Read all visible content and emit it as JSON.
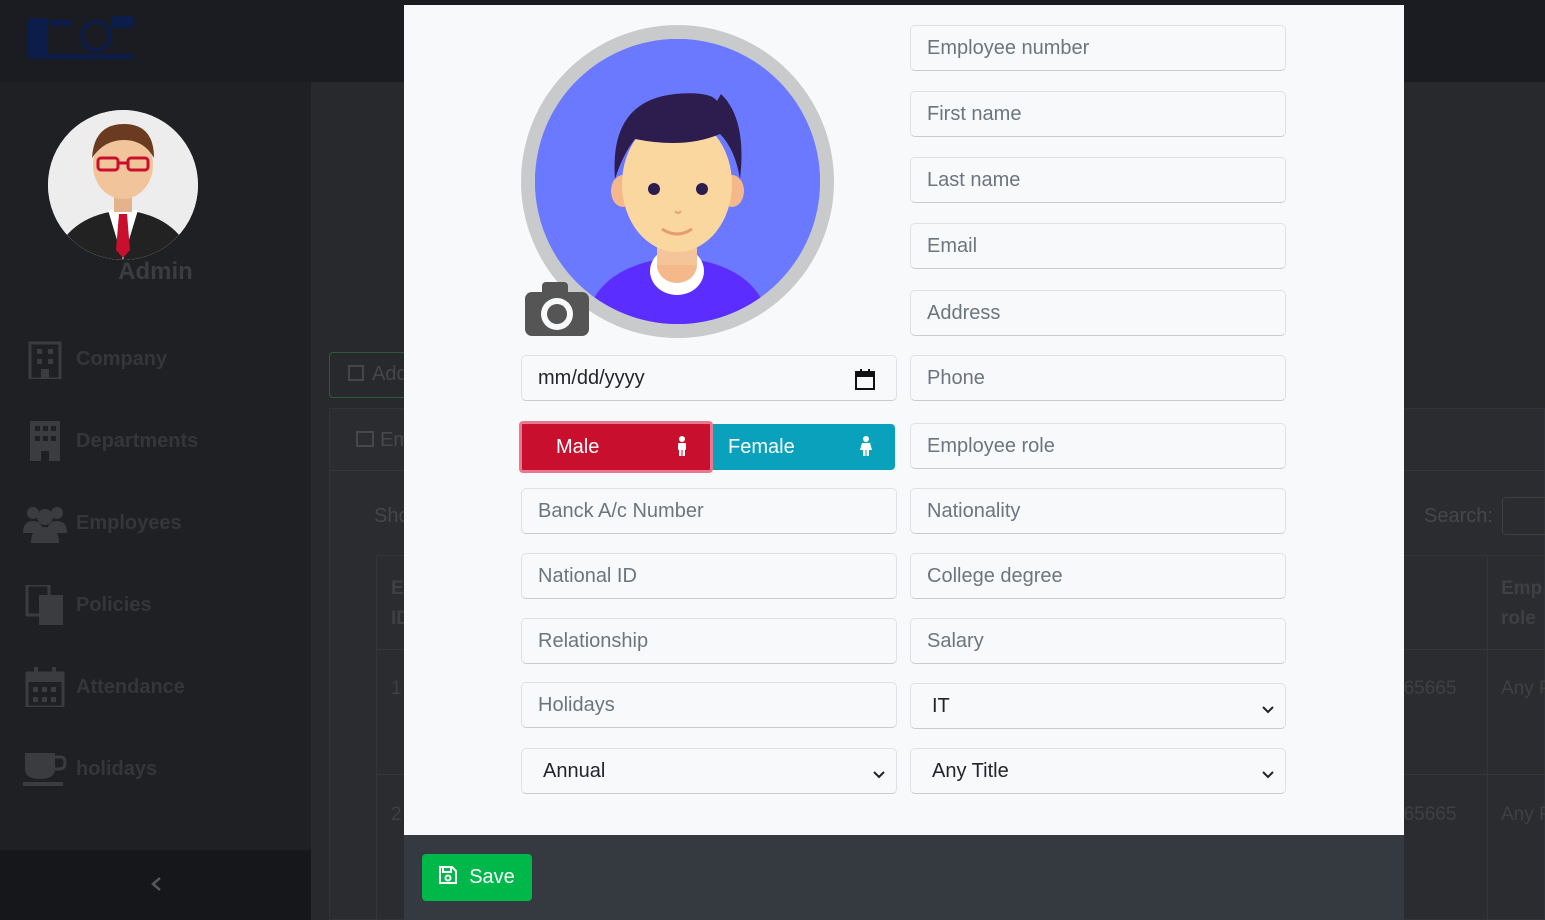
{
  "sidebar": {
    "admin_label": "Admin",
    "items": [
      {
        "label": "Company",
        "icon": "building-icon"
      },
      {
        "label": "Departments",
        "icon": "office-building-icon"
      },
      {
        "label": "Employees",
        "icon": "users-icon"
      },
      {
        "label": "Policies",
        "icon": "documents-icon"
      },
      {
        "label": "Attendance",
        "icon": "calendar-icon"
      },
      {
        "label": "holidays",
        "icon": "coffee-cup-icon"
      }
    ],
    "collapse_icon": "chevron-left-icon"
  },
  "background": {
    "add_button_label": "Add",
    "card_header_label": "Em",
    "show_label": "Sho",
    "search_label": "Search:",
    "table_headers": [
      "E",
      "ID",
      "e",
      "Emp",
      "role"
    ],
    "rows": [
      {
        "id": "1",
        "phone": "565665",
        "role": "Any P"
      },
      {
        "id": "2",
        "phone": "565665",
        "role": "Any P"
      }
    ]
  },
  "modal": {
    "date_placeholder": "mm/dd/yyyy",
    "gender": {
      "male_label": "Male",
      "female_label": "Female",
      "selected": "Male"
    },
    "left_fields": [
      {
        "placeholder": "Banck A/c Number"
      },
      {
        "placeholder": "National ID"
      },
      {
        "placeholder": "Relationship"
      },
      {
        "placeholder": "Holidays"
      }
    ],
    "leave_type_select": "Annual",
    "right_fields": [
      {
        "placeholder": "Employee number"
      },
      {
        "placeholder": "First name"
      },
      {
        "placeholder": "Last name"
      },
      {
        "placeholder": "Email"
      },
      {
        "placeholder": "Address"
      },
      {
        "placeholder": "Phone"
      },
      {
        "placeholder": "Employee role"
      },
      {
        "placeholder": "Nationality"
      },
      {
        "placeholder": "College degree"
      },
      {
        "placeholder": "Salary"
      }
    ],
    "department_select": "IT",
    "title_select": "Any Title",
    "save_label": "Save"
  },
  "colors": {
    "male": "#c8102e",
    "female": "#0aa1bc",
    "save": "#00b84a",
    "avatar_bg": "#6a79ff"
  }
}
